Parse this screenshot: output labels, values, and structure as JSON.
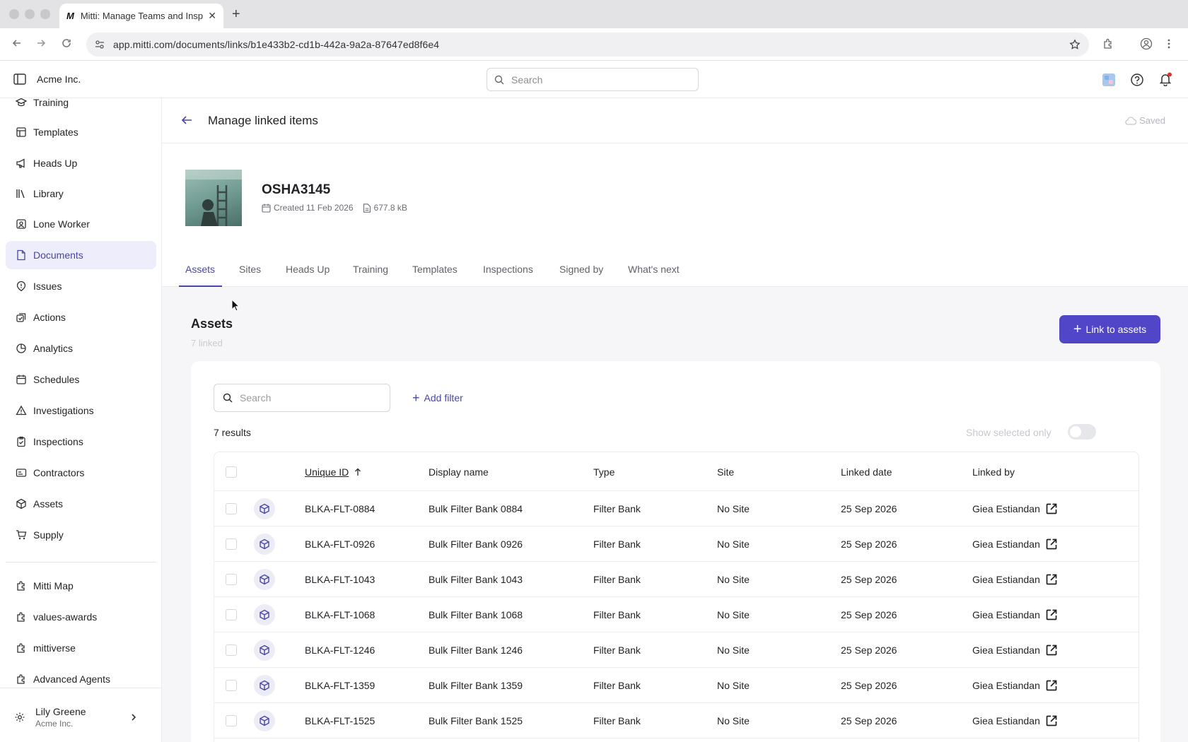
{
  "browser": {
    "tab_title": "Mitti: Manage Teams and Insp",
    "favicon": "M",
    "url": "app.mitti.com/documents/links/b1e433b2-cd1b-442a-9a2a-87647ed8f6e4"
  },
  "header": {
    "org": "Acme Inc.",
    "search_placeholder": "Search"
  },
  "sidebar": {
    "items": [
      {
        "label": "Training",
        "icon": "training-icon"
      },
      {
        "label": "Templates",
        "icon": "templates-icon"
      },
      {
        "label": "Heads Up",
        "icon": "megaphone-icon"
      },
      {
        "label": "Library",
        "icon": "library-icon"
      },
      {
        "label": "Lone Worker",
        "icon": "lone-worker-icon"
      },
      {
        "label": "Documents",
        "icon": "document-icon",
        "active": true
      },
      {
        "label": "Issues",
        "icon": "issues-icon"
      },
      {
        "label": "Actions",
        "icon": "actions-icon"
      },
      {
        "label": "Analytics",
        "icon": "analytics-icon"
      },
      {
        "label": "Schedules",
        "icon": "calendar-icon"
      },
      {
        "label": "Investigations",
        "icon": "investigations-icon"
      },
      {
        "label": "Inspections",
        "icon": "inspections-icon"
      },
      {
        "label": "Contractors",
        "icon": "contractors-icon"
      },
      {
        "label": "Assets",
        "icon": "cube-icon"
      },
      {
        "label": "Supply",
        "icon": "cart-icon"
      }
    ],
    "extras": [
      {
        "label": "Mitti Map",
        "icon": "puzzle-icon"
      },
      {
        "label": "values-awards",
        "icon": "puzzle-icon"
      },
      {
        "label": "mittiverse",
        "icon": "puzzle-icon"
      },
      {
        "label": "Advanced Agents",
        "icon": "puzzle-icon"
      }
    ],
    "user": {
      "name": "Lily Greene",
      "org": "Acme Inc."
    }
  },
  "page": {
    "title": "Manage linked items",
    "saved_label": "Saved"
  },
  "document": {
    "name": "OSHA3145",
    "created": "Created 11 Feb 2026",
    "size": "677.8 kB"
  },
  "tabs": [
    "Assets",
    "Sites",
    "Heads Up",
    "Training",
    "Templates",
    "Inspections",
    "Signed by",
    "What's next"
  ],
  "assets": {
    "title": "Assets",
    "subtitle": "7 linked",
    "link_button": "Link to assets",
    "search_placeholder": "Search",
    "add_filter": "Add filter",
    "results": "7 results",
    "show_selected": "Show selected only",
    "columns": [
      "Unique ID",
      "Display name",
      "Type",
      "Site",
      "Linked date",
      "Linked by"
    ],
    "rows": [
      [
        "BLKA-FLT-0884",
        "Bulk Filter Bank 0884",
        "Filter Bank",
        "No Site",
        "25 Sep 2026",
        "Giea Estiandan"
      ],
      [
        "BLKA-FLT-0926",
        "Bulk Filter Bank 0926",
        "Filter Bank",
        "No Site",
        "25 Sep 2026",
        "Giea Estiandan"
      ],
      [
        "BLKA-FLT-1043",
        "Bulk Filter Bank 1043",
        "Filter Bank",
        "No Site",
        "25 Sep 2026",
        "Giea Estiandan"
      ],
      [
        "BLKA-FLT-1068",
        "Bulk Filter Bank 1068",
        "Filter Bank",
        "No Site",
        "25 Sep 2026",
        "Giea Estiandan"
      ],
      [
        "BLKA-FLT-1246",
        "Bulk Filter Bank 1246",
        "Filter Bank",
        "No Site",
        "25 Sep 2026",
        "Giea Estiandan"
      ],
      [
        "BLKA-FLT-1359",
        "Bulk Filter Bank 1359",
        "Filter Bank",
        "No Site",
        "25 Sep 2026",
        "Giea Estiandan"
      ],
      [
        "BLKA-FLT-1525",
        "Bulk Filter Bank 1525",
        "Filter Bank",
        "No Site",
        "25 Sep 2026",
        "Giea Estiandan"
      ]
    ]
  },
  "colors": {
    "accent": "#5046c7",
    "active_bg": "#ededfb"
  }
}
